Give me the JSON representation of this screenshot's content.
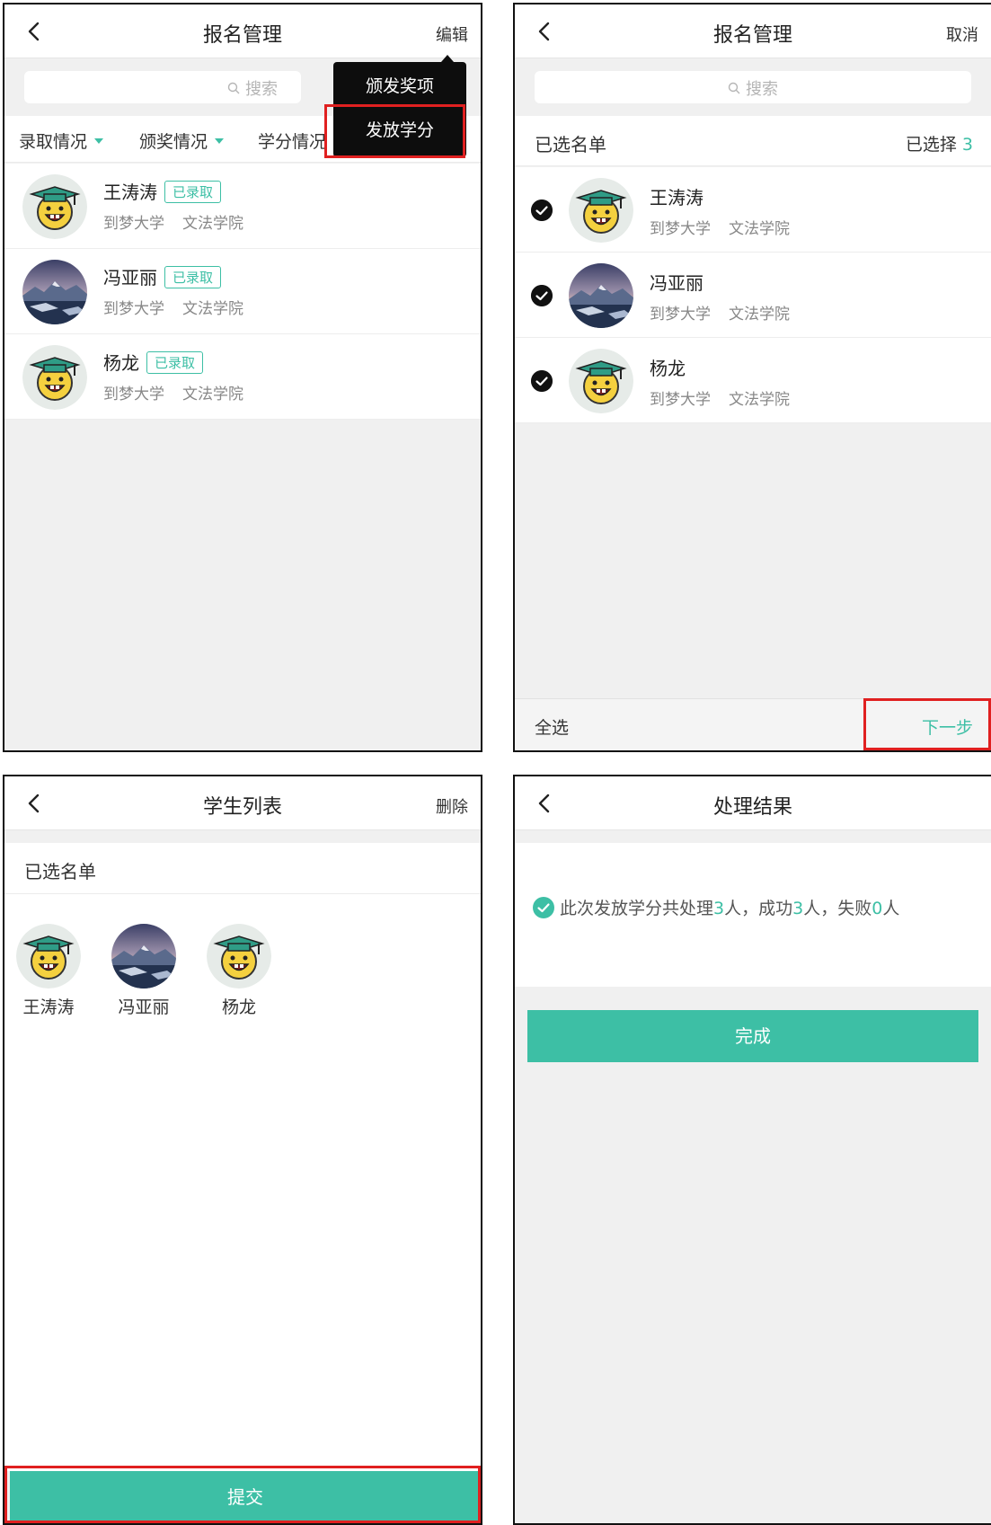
{
  "colors": {
    "accent": "#3dbfa5",
    "highlight": "#e02020",
    "menu_bg": "#0d0d0d"
  },
  "screen1": {
    "title": "报名管理",
    "right_action": "编辑",
    "search_placeholder": "搜索",
    "filters": [
      "录取情况",
      "颁奖情况",
      "学分情况"
    ],
    "menu": [
      "颁发奖项",
      "发放学分"
    ],
    "highlighted_menu_item": "发放学分",
    "students": [
      {
        "name": "王涛涛",
        "badge": "已录取",
        "school": "到梦大学",
        "college": "文法学院",
        "avatar": "graduate-cap-face"
      },
      {
        "name": "冯亚丽",
        "badge": "已录取",
        "school": "到梦大学",
        "college": "文法学院",
        "avatar": "mountain-lake-photo"
      },
      {
        "name": "杨龙",
        "badge": "已录取",
        "school": "到梦大学",
        "college": "文法学院",
        "avatar": "graduate-cap-face"
      }
    ]
  },
  "screen2": {
    "title": "报名管理",
    "right_action": "取消",
    "search_placeholder": "搜索",
    "section_title": "已选名单",
    "selected_label": "已选择",
    "selected_count": "3",
    "students": [
      {
        "name": "王涛涛",
        "school": "到梦大学",
        "college": "文法学院",
        "checked": true
      },
      {
        "name": "冯亚丽",
        "school": "到梦大学",
        "college": "文法学院",
        "checked": true
      },
      {
        "name": "杨龙",
        "school": "到梦大学",
        "college": "文法学院",
        "checked": true
      }
    ],
    "select_all": "全选",
    "next": "下一步"
  },
  "screen3": {
    "title": "学生列表",
    "right_action": "删除",
    "section_title": "已选名单",
    "students": [
      "王涛涛",
      "冯亚丽",
      "杨龙"
    ],
    "submit": "提交"
  },
  "screen4": {
    "title": "处理结果",
    "result": {
      "prefix": "此次发放学分共处理",
      "total": "3",
      "mid1": "人，成功",
      "success": "3",
      "mid2": "人，失败",
      "failed": "0",
      "suffix": "人"
    },
    "done": "完成"
  }
}
